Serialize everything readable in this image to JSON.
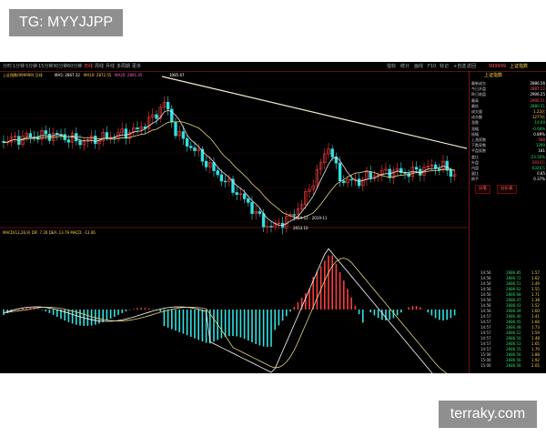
{
  "watermarks": {
    "top": "TG: MYYJJPP",
    "bottom": "terraky.com"
  },
  "colors": {
    "background": "#000000",
    "up": "#ff3b3b",
    "down": "#33e0e0",
    "ma_white": "#e6e6e6",
    "ma_yellow": "#e8d37a",
    "trendline": "#f2efc8",
    "panel_border": "#7a1515"
  },
  "menu": {
    "left_items": [
      "分时",
      "1分钟",
      "5分钟",
      "15分钟",
      "30分钟",
      "60分钟",
      "日线",
      "周线",
      "月线",
      "多周期",
      "更多"
    ],
    "right_items": [
      "指标",
      "统计",
      "画线",
      "F10",
      "标记",
      "+自选",
      "返回"
    ],
    "code": "999999",
    "name": "上证指数"
  },
  "info_line": {
    "title": "上证指数(999999) 日线",
    "ma": [
      "MA5: 2867.32",
      "MA10: 2872.55",
      "MA20: 2891.45"
    ]
  },
  "macd_label": "MACD(12,26,9) DIF: 7.26 DEA: 13.79 MACD: -13.06",
  "chart_annotations": {
    "peak_label": "3085.67",
    "low_label": "2653.10",
    "range_label": "2019-12 - 2019-11"
  },
  "right_panel": {
    "title": "上证指数",
    "rows": [
      {
        "label": "最新成交",
        "value": "2886.56",
        "color": "#ffffff"
      },
      {
        "label": "今日开盘",
        "value": "2887.52",
        "color": "#ff5555"
      },
      {
        "label": "昨日收盘",
        "value": "2906.25",
        "color": "#ffffff"
      },
      {
        "label": "最高",
        "value": "2906.51",
        "color": "#ff5555"
      },
      {
        "label": "最低",
        "value": "2880.51",
        "color": "#33dd66"
      },
      {
        "label": "成交量",
        "value": "1.22亿",
        "color": "#ffd24a"
      },
      {
        "label": "成交额",
        "value": "1277亿",
        "color": "#ffd24a"
      },
      {
        "label": "涨跌",
        "value": "-19.69",
        "color": "#33dd66"
      },
      {
        "label": "涨幅",
        "value": "-0.68%",
        "color": "#33dd66"
      },
      {
        "label": "振幅",
        "value": "0.89%",
        "color": "#ffffff"
      },
      {
        "label": "上涨家数",
        "value": "588",
        "color": "#ff5555"
      },
      {
        "label": "下跌家数",
        "value": "1290",
        "color": "#33dd66"
      },
      {
        "label": "平盘家数",
        "value": "181",
        "color": "#ffffff"
      },
      {
        "label": "委比",
        "value": "-23.56%",
        "color": "#33dd66"
      },
      {
        "label": "外盘",
        "value": "5914万",
        "color": "#ff5555"
      },
      {
        "label": "内盘",
        "value": "6326万",
        "color": "#33dd66"
      },
      {
        "label": "量比",
        "value": "0.85",
        "color": "#ffffff"
      },
      {
        "label": "换手",
        "value": "0.37%",
        "color": "#ffffff"
      }
    ],
    "tabs": [
      "分笔",
      "分价表"
    ],
    "ticks": [
      {
        "time": "14:56",
        "price": "2886.85",
        "vol": "1.57"
      },
      {
        "time": "14:56",
        "price": "2886.72",
        "vol": "1.62"
      },
      {
        "time": "14:56",
        "price": "2886.51",
        "vol": "1.49"
      },
      {
        "time": "14:56",
        "price": "2886.62",
        "vol": "1.55"
      },
      {
        "time": "14:56",
        "price": "2886.68",
        "vol": "1.71"
      },
      {
        "time": "14:56",
        "price": "2886.47",
        "vol": "1.38"
      },
      {
        "time": "14:56",
        "price": "2886.43",
        "vol": "1.52"
      },
      {
        "time": "14:56",
        "price": "2886.39",
        "vol": "1.60"
      },
      {
        "time": "14:57",
        "price": "2886.40",
        "vol": "1.41"
      },
      {
        "time": "14:57",
        "price": "2886.45",
        "vol": "1.66"
      },
      {
        "time": "14:57",
        "price": "2886.48",
        "vol": "1.73"
      },
      {
        "time": "14:57",
        "price": "2886.52",
        "vol": "1.59"
      },
      {
        "time": "14:57",
        "price": "2886.50",
        "vol": "1.48"
      },
      {
        "time": "14:57",
        "price": "2886.53",
        "vol": "1.65"
      },
      {
        "time": "14:57",
        "price": "2886.55",
        "vol": "1.70"
      },
      {
        "time": "15:00",
        "price": "2886.56",
        "vol": "1.88"
      },
      {
        "time": "15:00",
        "price": "2886.56",
        "vol": "1.92"
      },
      {
        "time": "15:00",
        "price": "2886.56",
        "vol": "2.05"
      }
    ]
  }
}
